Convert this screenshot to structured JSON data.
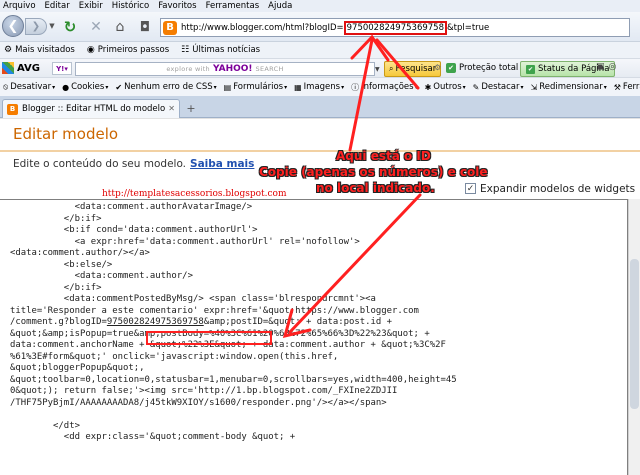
{
  "menu": [
    "Arquivo",
    "Editar",
    "Exibir",
    "Histórico",
    "Favoritos",
    "Ferramentas",
    "Ajuda"
  ],
  "url": {
    "prefix": "http://www.blogger.com/html?blogID=",
    "blog_id": "975002824975369758",
    "suffix": "&tpl=true"
  },
  "bookmarks": [
    {
      "icon": "gear-icon",
      "label": "Mais visitados"
    },
    {
      "icon": "firefox-icon",
      "label": "Primeiros passos"
    },
    {
      "icon": "rss-icon",
      "label": "Últimas notícias"
    }
  ],
  "avg": {
    "logo": "AVG",
    "search_placeholder": "explore with",
    "search_brand": "YAHOO!",
    "search_suffix": "SEARCH",
    "search_button": "Pesquisar",
    "protection": "Proteção total",
    "status_button": "Status da Página"
  },
  "devbar": [
    {
      "icon": "no-entry-icon",
      "label": "Desativar"
    },
    {
      "icon": "cookie-icon",
      "label": "Cookies"
    },
    {
      "icon": "css-icon",
      "label": "Nenhum erro de CSS"
    },
    {
      "icon": "form-icon",
      "label": "Formulários"
    },
    {
      "icon": "image-icon",
      "label": "Imagens"
    },
    {
      "icon": "info-icon",
      "label": "Informações"
    },
    {
      "icon": "others-icon",
      "label": "Outros"
    },
    {
      "icon": "highlight-icon",
      "label": "Destacar"
    },
    {
      "icon": "resize-icon",
      "label": "Redimensionar"
    },
    {
      "icon": "tools-icon",
      "label": "Ferramen"
    }
  ],
  "tab": {
    "title": "Blogger :: Editar HTML do modelo"
  },
  "page": {
    "title": "Editar modelo",
    "subtitle": "Edite o conteúdo do seu modelo.",
    "help_link": "Saiba mais",
    "watermark": "http://templatesacessorios.blogspot.com",
    "expand_label": "Expandir modelos de widgets"
  },
  "annotation": {
    "line1": "Aqui está o ID",
    "line2": "Copie (apenas os números) e cole",
    "line3": "no local indicado."
  },
  "code_lines": [
    "            <data:comment.authorAvatarImage/>",
    "          </b:if>",
    "          <b:if cond='data:comment.authorUrl'>",
    "            <a expr:href='data:comment.authorUrl' rel='nofollow'>",
    "<data:comment.author/></a>",
    "          <b:else/>",
    "            <data:comment.author/>",
    "          </b:if>",
    "          <data:commentPostedByMsg/> <span class='blrespondrcmnt'><a",
    "title='Responder a este comentario' expr:href='&quot;https://www.blogger.com",
    "/comment.g?blogID=|975002824975369758|&amp;postID=&quot; + data:post.id +",
    "&quot;&amp;isPopup=true&amp;postBody=%40%3C%61%20%68%72%65%66%3D%22%23&quot; +",
    "data:comment.anchorName + &quot;%22%3E&quot; + data:comment.author + &quot;%3C%2F",
    "%61%3E#form&quot;' onclick='javascript:window.open(this.href,",
    "&quot;bloggerPopup&quot;,",
    "&quot;toolbar=0,location=0,statusbar=1,menubar=0,scrollbars=yes,width=400,height=45",
    "0&quot;); return false;'><img src='http://1.bp.blogspot.com/_FXIne2ZDJII",
    "/THF75PyBjmI/AAAAAAAADA8/j45tkW9XIOY/s1600/responder.png'/></a></span>",
    "",
    "        </dt>",
    "          <dd expr:class='&quot;comment-body &quot; +"
  ]
}
